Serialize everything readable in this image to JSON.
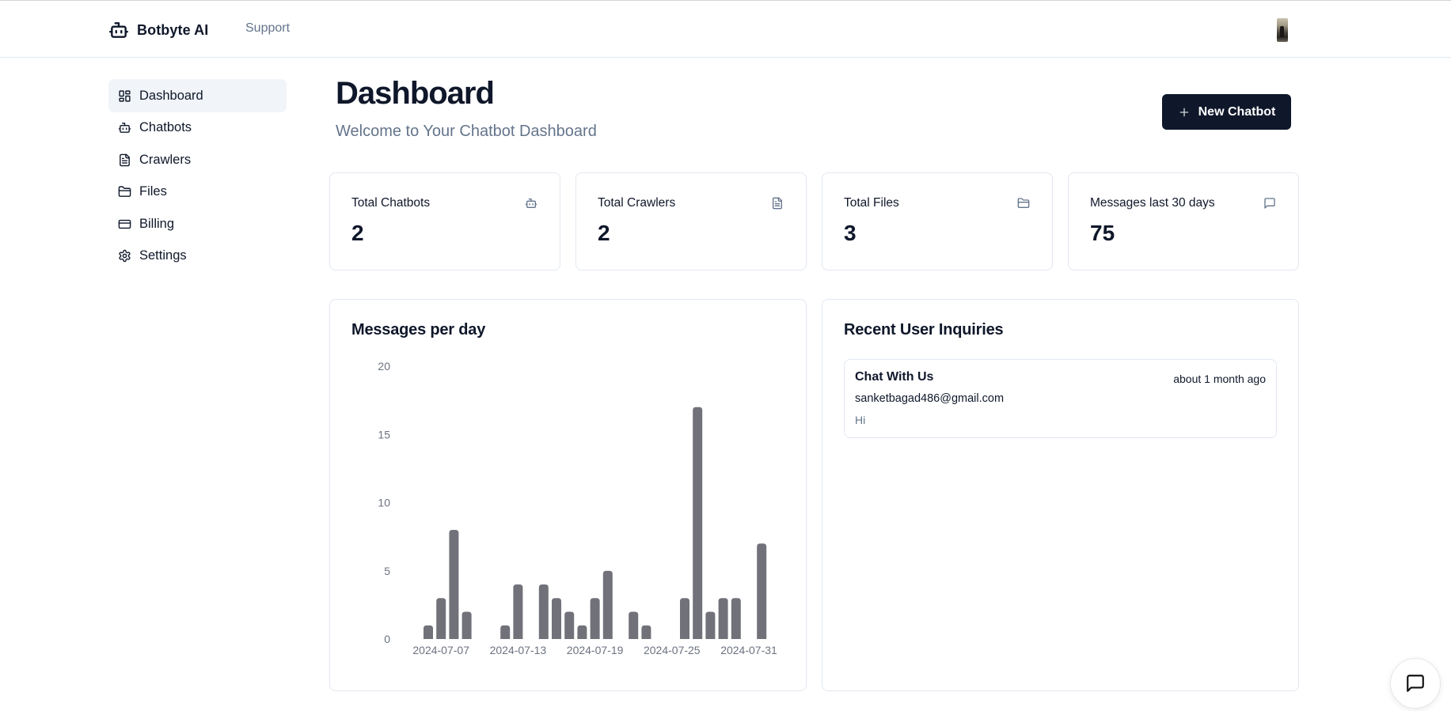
{
  "header": {
    "brand": "Botbyte AI",
    "brand_icon": "bot-icon",
    "nav": [
      {
        "label": "Support"
      }
    ],
    "avatar": "user-avatar"
  },
  "sidebar": {
    "active": "Dashboard",
    "items": [
      {
        "label": "Dashboard",
        "icon": "layout-dashboard-icon"
      },
      {
        "label": "Chatbots",
        "icon": "bot-icon"
      },
      {
        "label": "Crawlers",
        "icon": "file-text-icon"
      },
      {
        "label": "Files",
        "icon": "folder-icon"
      },
      {
        "label": "Billing",
        "icon": "credit-card-icon"
      },
      {
        "label": "Settings",
        "icon": "settings-gear-icon"
      }
    ]
  },
  "main": {
    "title": "Dashboard",
    "subtitle": "Welcome to Your Chatbot Dashboard",
    "new_button": "New Chatbot",
    "stats": [
      {
        "label": "Total Chatbots",
        "value": "2",
        "icon": "bot-icon"
      },
      {
        "label": "Total Crawlers",
        "value": "2",
        "icon": "file-text-icon"
      },
      {
        "label": "Total Files",
        "value": "3",
        "icon": "folder-icon"
      },
      {
        "label": "Messages last 30 days",
        "value": "75",
        "icon": "message-square-icon"
      }
    ],
    "chart_panel_title": "Messages per day",
    "inquiries_title": "Recent User Inquiries",
    "inquiries": [
      {
        "title": "Chat With Us",
        "time": "about 1 month ago",
        "email": "sanketbagad486@gmail.com",
        "message": "Hi"
      }
    ]
  },
  "colors": {
    "primary": "#0f172a",
    "muted": "#64748b",
    "bar": "#71717a",
    "border": "#e2e8f0",
    "active_bg": "#f1f5f9"
  },
  "chart_data": {
    "type": "bar",
    "title": "Messages per day",
    "xlabel": "",
    "ylabel": "",
    "ylim": [
      0,
      20
    ],
    "yticks": [
      0,
      5,
      10,
      15,
      20
    ],
    "xtick_labels": [
      "2024-07-07",
      "2024-07-13",
      "2024-07-19",
      "2024-07-25",
      "2024-07-31"
    ],
    "grid": false,
    "categories": [
      "2024-07-06",
      "2024-07-07",
      "2024-07-08",
      "2024-07-09",
      "2024-07-10",
      "2024-07-11",
      "2024-07-12",
      "2024-07-13",
      "2024-07-14",
      "2024-07-15",
      "2024-07-16",
      "2024-07-17",
      "2024-07-18",
      "2024-07-19",
      "2024-07-20",
      "2024-07-21",
      "2024-07-22",
      "2024-07-23",
      "2024-07-24",
      "2024-07-25",
      "2024-07-26",
      "2024-07-27",
      "2024-07-28",
      "2024-07-29",
      "2024-07-30",
      "2024-07-31",
      "2024-08-01"
    ],
    "values": [
      1,
      3,
      8,
      2,
      0,
      0,
      1,
      4,
      0,
      4,
      3,
      2,
      1,
      3,
      5,
      0,
      2,
      1,
      0,
      0,
      3,
      17,
      2,
      3,
      3,
      0,
      7
    ]
  },
  "chat_widget": {
    "icon": "message-square-icon"
  }
}
